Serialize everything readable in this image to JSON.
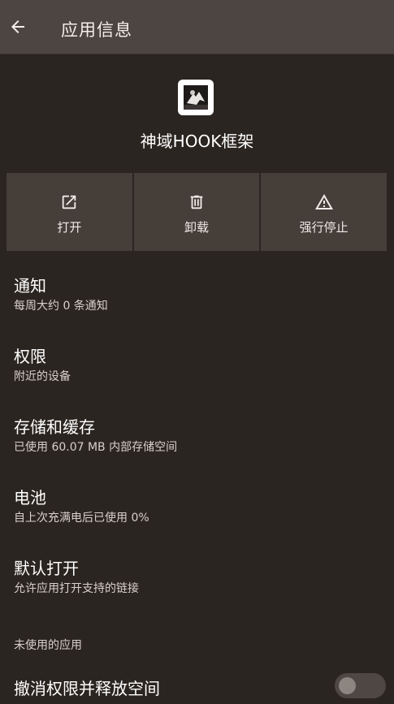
{
  "appbar": {
    "title": "应用信息",
    "back_icon": "arrow-back-icon"
  },
  "app": {
    "name": "神域HOOK框架",
    "icon": "app-icon"
  },
  "actions": [
    {
      "label": "打开",
      "icon": "open-external-icon"
    },
    {
      "label": "卸载",
      "icon": "trash-icon"
    },
    {
      "label": "强行停止",
      "icon": "warning-icon"
    }
  ],
  "items": [
    {
      "title": "通知",
      "summary": "每周大约 0 条通知"
    },
    {
      "title": "权限",
      "summary": "附近的设备"
    },
    {
      "title": "存储和缓存",
      "summary": "已使用 60.07 MB 内部存储空间"
    },
    {
      "title": "电池",
      "summary": "自上次充满电后已使用 0%"
    },
    {
      "title": "默认打开",
      "summary": "允许应用打开支持的链接"
    }
  ],
  "unused_section": {
    "header": "未使用的应用",
    "revoke_title": "撤消权限并释放空间",
    "revoke_enabled": false
  },
  "colors": {
    "background": "#2b2521",
    "appbar": "#4c4541",
    "button": "#453e39"
  }
}
